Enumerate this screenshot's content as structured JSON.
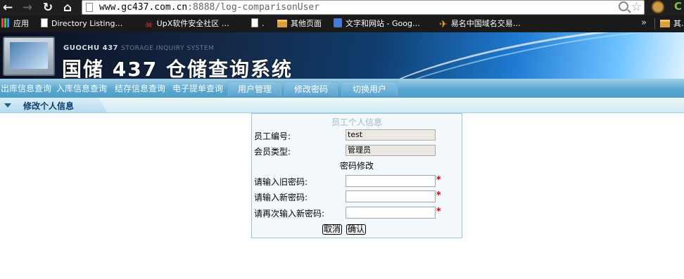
{
  "browser": {
    "url_host": "www.gc437.com.cn",
    "url_rest": ":8888/log-comparisonUser",
    "bookmarks": [
      {
        "label": "应用",
        "icon": "apps-icon"
      },
      {
        "label": "Directory Listing…",
        "icon": "page-icon"
      },
      {
        "label": "UpX软件安全社区 …",
        "icon": "upx-icon"
      },
      {
        "label": ".",
        "icon": "page-icon"
      },
      {
        "label": "其他页面",
        "icon": "folder-icon"
      },
      {
        "label": "文字和网站 - Goog…",
        "icon": "translate-icon"
      },
      {
        "label": "易名中国域名交易…",
        "icon": "ename-icon"
      }
    ],
    "more": "»",
    "overflow_folder": "其…"
  },
  "banner": {
    "brand_en": "GUOCHU 437",
    "brand_en_sub": "STORAGE INQUIRY SYSTEM",
    "title": "国储 437 仓储查询系统"
  },
  "menu": [
    "出库信息查询",
    "入库信息查询",
    "结存信息查询",
    "电子提单查询",
    "用户管理",
    "修改密码",
    "切换用户"
  ],
  "subbar": {
    "title": "修改个人信息"
  },
  "form": {
    "title": "员工个人信息",
    "employee_id_label": "员工编号:",
    "employee_id_value": "test",
    "member_type_label": "会员类型:",
    "member_type_value": "管理员",
    "section_title": "密码修改",
    "old_password_label": "请输入旧密码:",
    "new_password_label": "请输入新密码:",
    "confirm_password_label": "请再次输入新密码:",
    "required_mark": "*",
    "cancel_label": "取消",
    "confirm_label": "确认"
  },
  "colors": {
    "menu_bar": "#5aa9d3",
    "panel_bg": "#f4f9fd",
    "required": "#e00000"
  }
}
